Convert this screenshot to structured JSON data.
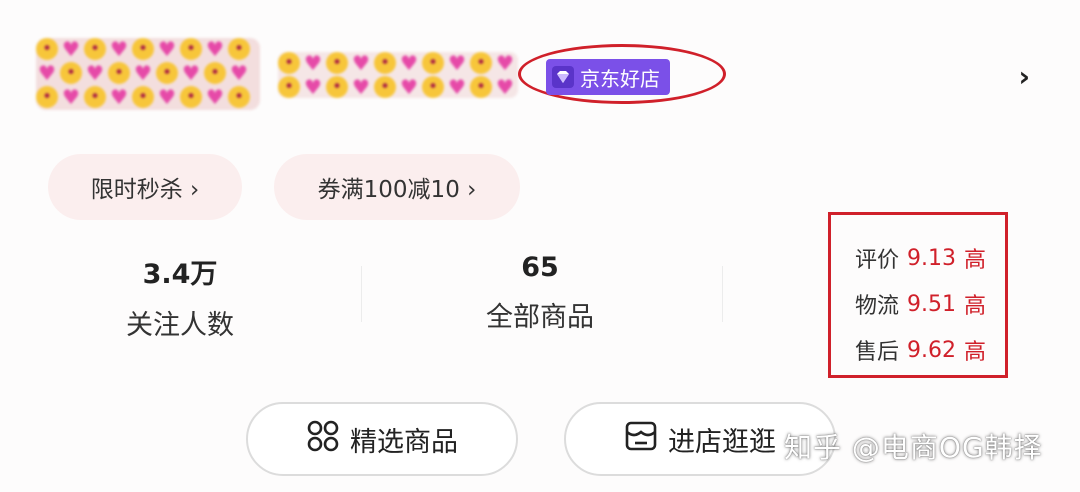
{
  "header": {
    "badge_label": "京东好店",
    "badge_icon": "diamond-icon",
    "chevron": "›"
  },
  "promos": [
    {
      "label": "限时秒杀 ›"
    },
    {
      "label": "券满100减10 ›"
    }
  ],
  "stats": [
    {
      "value": "3.4万",
      "label": "关注人数"
    },
    {
      "value": "65",
      "label": "全部商品"
    }
  ],
  "scores": [
    {
      "key": "评价",
      "value": "9.13",
      "level": "高"
    },
    {
      "key": "物流",
      "value": "9.51",
      "level": "高"
    },
    {
      "key": "售后",
      "value": "9.62",
      "level": "高"
    }
  ],
  "buttons": [
    {
      "label": "精选商品",
      "icon": "grid-icon"
    },
    {
      "label": "进店逛逛",
      "icon": "store-icon"
    }
  ],
  "watermark": "知乎 @电商OG韩择",
  "colors": {
    "accent_red": "#d0202a",
    "badge_purple": "#7b50e8"
  }
}
